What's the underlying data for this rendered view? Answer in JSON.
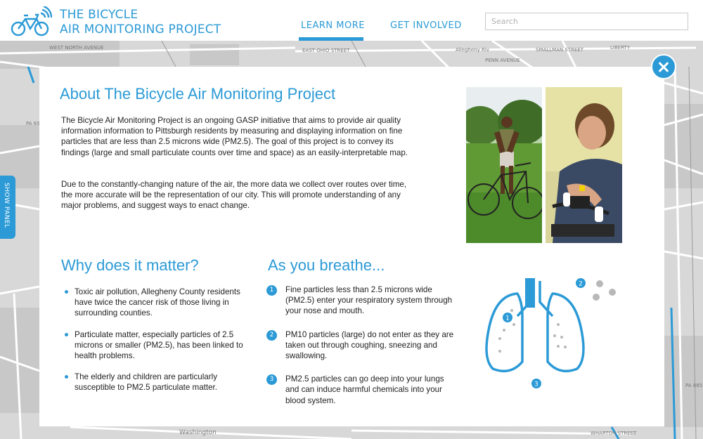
{
  "brand": {
    "line1": "THE BICYCLE",
    "line2": "AIR MONITORING PROJECT",
    "logo_icon": "bicycle-signal-icon"
  },
  "nav": {
    "learn_more": "LEARN MORE",
    "get_involved": "GET INVOLVED",
    "active": "LEARN MORE"
  },
  "search": {
    "placeholder": "Search"
  },
  "side_tab": {
    "label": "SHOW PANEL"
  },
  "map": {
    "labels": [
      "WEST NORTH AVENUE",
      "EAST OHIO STREET",
      "PA 65",
      "PA 885",
      "WHARTON STREET",
      "Washington",
      "Allegheny Riv",
      "LIBERTY",
      "SMALLMAN STREET",
      "PENN AVENUE"
    ]
  },
  "modal": {
    "close_icon": "close-icon",
    "about": {
      "title": "About The Bicycle Air Monitoring Project",
      "p1": "The Bicycle Air Monitoring Project is an ongoing GASP initiative that aims to provide air quality information information to Pittsburgh residents by measuring and displaying information on fine particles that are less than 2.5 microns wide (PM2.5). The goal of this project is to convey its findings (large and small particulate counts over time and space) as an easily-interpretable map.",
      "p2": "Due to the constantly-changing nature of the air, the more data we collect over routes over time, the more accurate will be the representation of our city.  This will promote understanding of any major problems, and suggest ways to enact change."
    },
    "why": {
      "title": "Why does it matter?",
      "bullets": [
        "Toxic air pollution, Allegheny County residents have twice the cancer risk of those living in surrounding counties.",
        "Particulate matter, especially particles of 2.5 microns or smaller (PM2.5), has been linked to health problems.",
        "The elderly and children are particularly susceptible to PM2.5 particulate matter."
      ]
    },
    "breathe": {
      "title": "As you breathe...",
      "steps": [
        {
          "num": "1",
          "text": "Fine particles less than 2.5 microns wide (PM2.5) enter your respiratory system through your nose and mouth."
        },
        {
          "num": "2",
          "text": "PM10 particles (large) do not enter as they are taken out through coughing, sneezing and swallowing."
        },
        {
          "num": "3",
          "text": "PM2.5 particles can go deep into your lungs and can induce harmful chemicals into your blood system."
        }
      ]
    },
    "diagram": {
      "labels": [
        "1",
        "2",
        "3"
      ]
    }
  },
  "colors": {
    "accent": "#2b9ad6",
    "map_bg": "#d8d8d8"
  }
}
